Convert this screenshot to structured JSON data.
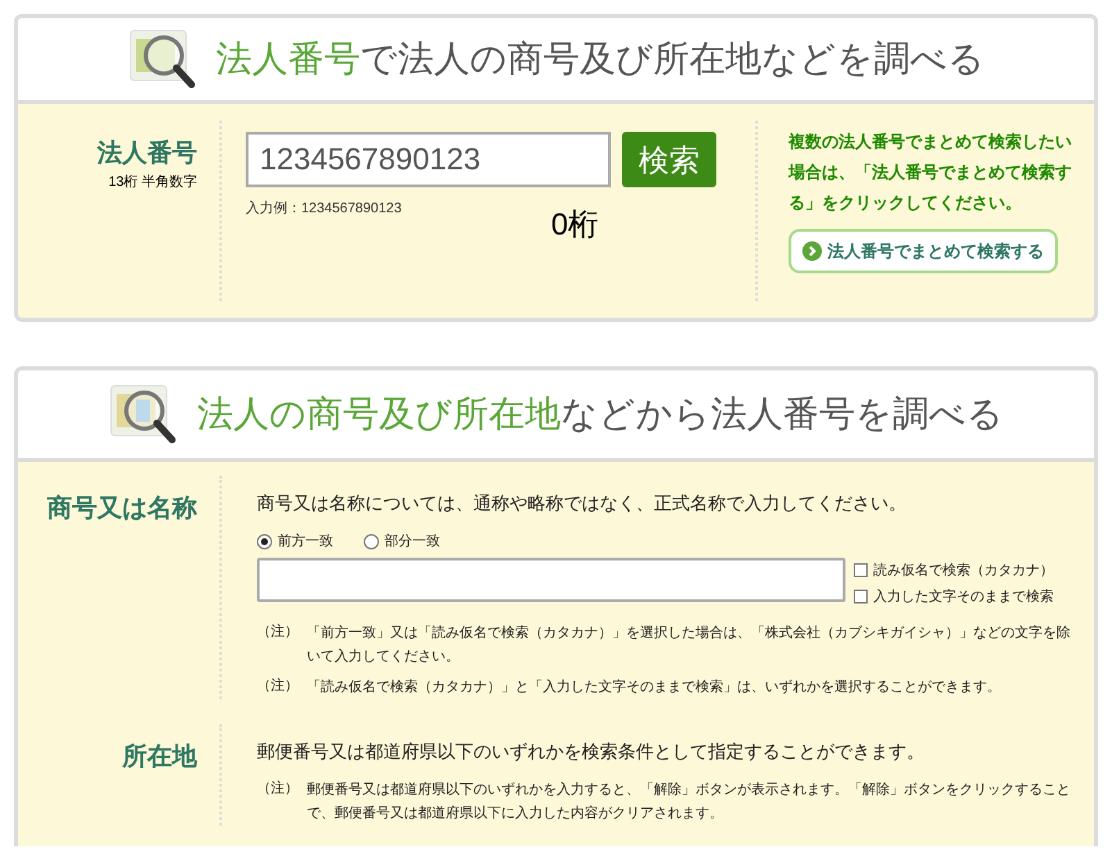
{
  "number_search": {
    "title_highlight": "法人番号",
    "title_rest": "で法人の商号及び所在地などを調べる",
    "label": "法人番号",
    "sublabel": "13桁 半角数字",
    "input_value": "1234567890123",
    "search_button": "検索",
    "example": "入力例：1234567890123",
    "digit_count": "0桁",
    "bulk_note": "複数の法人番号でまとめて検索したい場合は、「法人番号でまとめて検索する」をクリックしてください。",
    "bulk_button": "法人番号でまとめて検索する"
  },
  "name_search": {
    "title_highlight": "法人の商号及び所在地",
    "title_rest": "などから法人番号を調べる",
    "rows": [
      {
        "kind": "name",
        "label": "商号又は名称",
        "intro": "商号又は名称については、通称や略称ではなく、正式名称で入力してください。",
        "match_options": [
          {
            "label": "前方一致",
            "selected": true
          },
          {
            "label": "部分一致",
            "selected": false
          }
        ],
        "options": [
          {
            "label": "読み仮名で検索（カタカナ）",
            "checked": false
          },
          {
            "label": "入力した文字そのままで検索",
            "checked": false
          }
        ],
        "notes": [
          {
            "mark": "（注）",
            "text": "「前方一致」又は「読み仮名で検索（カタカナ）」を選択した場合は、「株式会社（カブシキガイシャ）」などの文字を除いて入力してください。"
          },
          {
            "mark": "（注）",
            "text": "「読み仮名で検索（カタカナ）」と「入力した文字そのままで検索」は、いずれかを選択することができます。"
          }
        ]
      },
      {
        "kind": "address",
        "label": "所在地",
        "intro": "郵便番号又は都道府県以下のいずれかを検索条件として指定することができます。",
        "notes": [
          {
            "mark": "（注）",
            "text": "郵便番号又は都道府県以下のいずれかを入力すると、「解除」ボタンが表示されます。「解除」ボタンをクリックすることで、郵便番号又は都道府県以下に入力した内容がクリアされます。"
          }
        ]
      }
    ]
  }
}
